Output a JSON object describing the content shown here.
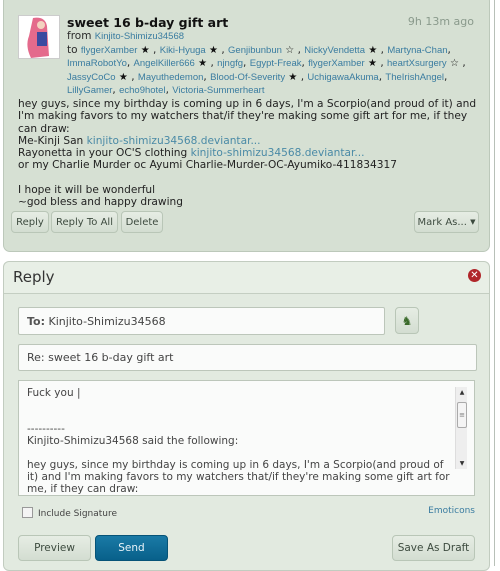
{
  "message": {
    "title": "sweet 16 b-day gift art",
    "time": "9h 13m ago",
    "from_label": "from",
    "from": "Kinjito-Shimizu34568",
    "to_label": "to",
    "recipients": [
      {
        "name": "flygerXamber",
        "star": "★"
      },
      {
        "name": "Kiki-Hyuga",
        "star": "★"
      },
      {
        "name": "Genjibunbun",
        "star": "☆"
      },
      {
        "name": "NickyVendetta",
        "star": "★"
      },
      {
        "name": "Martyna-Chan",
        "star": ""
      },
      {
        "name": "ImmaRobotYo",
        "star": ""
      },
      {
        "name": "AngelKiller666",
        "star": "★"
      },
      {
        "name": "njngfg",
        "star": ""
      },
      {
        "name": "Egypt-Freak",
        "star": ""
      },
      {
        "name": "flygerXamber",
        "star": "★"
      },
      {
        "name": "heartXsurgery",
        "star": "☆"
      },
      {
        "name": "JassyCoCo",
        "star": "★"
      },
      {
        "name": "Mayuthedemon",
        "star": ""
      },
      {
        "name": "Blood-Of-Severity",
        "star": "★"
      },
      {
        "name": "UchigawaAkuma",
        "star": ""
      },
      {
        "name": "TheIrishAngel",
        "star": ""
      },
      {
        "name": "LillyGamer",
        "star": ""
      },
      {
        "name": "echo9hotel",
        "star": ""
      },
      {
        "name": "Victoria-Summerheart",
        "star": ""
      }
    ],
    "body_intro": "hey guys, since my birthday is coming up in 6 days, I'm a Scorpio(and proud of it) and I'm making favors to my watchers that/if they're making some gift art for me, if they can draw:",
    "line1_text": "Me-Kinji San ",
    "line1_link": "kinjito-shimizu34568.deviantar...",
    "line2_text": "Rayonetta in your OC'S clothing ",
    "line2_link": "kinjito-shimizu34568.deviantar...",
    "line3_text": "or my Charlie Murder oc Ayumi Charlie-Murder-OC-Ayumiko-411834317",
    "line4_text": "I hope it will be wonderful",
    "line5_text": "~god bless and happy drawing",
    "buttons": {
      "reply": "Reply",
      "reply_all": "Reply To All",
      "delete": "Delete",
      "mark_as": "Mark As..."
    }
  },
  "reply": {
    "title": "Reply",
    "to_label": "To:",
    "to_value": "Kinjito-Shimizu34568",
    "subject": "Re: sweet 16 b-day gift art",
    "body": "Fuck you |\n\n\n----------\nKinjito-Shimizu34568 said the following:\n\nhey guys, since my birthday is coming up in 6 days, I'm a Scorpio(and proud of it) and I'm making favors to my watchers that/if they're making some gift art for me, if they can draw:",
    "include_signature": "Include Signature",
    "signature_checked": false,
    "emoticons": "Emoticons",
    "preview": "Preview",
    "send": "Send",
    "save_draft": "Save As Draft"
  },
  "colors": {
    "panel": "#d6e0d3",
    "link": "#3a7ca0",
    "send": "#0c6c96",
    "close": "#b0262a"
  }
}
